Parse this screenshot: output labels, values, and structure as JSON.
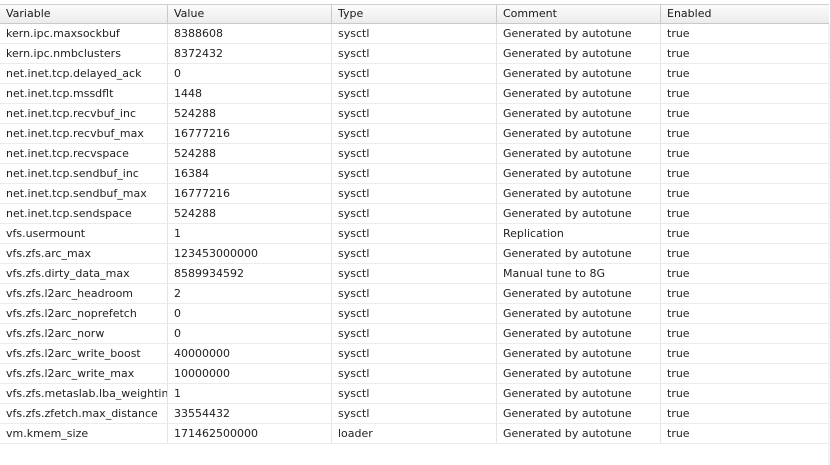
{
  "columns": [
    "Variable",
    "Value",
    "Type",
    "Comment",
    "Enabled"
  ],
  "rows": [
    {
      "variable": "kern.ipc.maxsockbuf",
      "value": "8388608",
      "type": "sysctl",
      "comment": "Generated by autotune",
      "enabled": "true"
    },
    {
      "variable": "kern.ipc.nmbclusters",
      "value": "8372432",
      "type": "sysctl",
      "comment": "Generated by autotune",
      "enabled": "true"
    },
    {
      "variable": "net.inet.tcp.delayed_ack",
      "value": "0",
      "type": "sysctl",
      "comment": "Generated by autotune",
      "enabled": "true"
    },
    {
      "variable": "net.inet.tcp.mssdflt",
      "value": "1448",
      "type": "sysctl",
      "comment": "Generated by autotune",
      "enabled": "true"
    },
    {
      "variable": "net.inet.tcp.recvbuf_inc",
      "value": "524288",
      "type": "sysctl",
      "comment": "Generated by autotune",
      "enabled": "true"
    },
    {
      "variable": "net.inet.tcp.recvbuf_max",
      "value": "16777216",
      "type": "sysctl",
      "comment": "Generated by autotune",
      "enabled": "true"
    },
    {
      "variable": "net.inet.tcp.recvspace",
      "value": "524288",
      "type": "sysctl",
      "comment": "Generated by autotune",
      "enabled": "true"
    },
    {
      "variable": "net.inet.tcp.sendbuf_inc",
      "value": "16384",
      "type": "sysctl",
      "comment": "Generated by autotune",
      "enabled": "true"
    },
    {
      "variable": "net.inet.tcp.sendbuf_max",
      "value": "16777216",
      "type": "sysctl",
      "comment": "Generated by autotune",
      "enabled": "true"
    },
    {
      "variable": "net.inet.tcp.sendspace",
      "value": "524288",
      "type": "sysctl",
      "comment": "Generated by autotune",
      "enabled": "true"
    },
    {
      "variable": "vfs.usermount",
      "value": "1",
      "type": "sysctl",
      "comment": "Replication",
      "enabled": "true"
    },
    {
      "variable": "vfs.zfs.arc_max",
      "value": "123453000000",
      "type": "sysctl",
      "comment": "Generated by autotune",
      "enabled": "true"
    },
    {
      "variable": "vfs.zfs.dirty_data_max",
      "value": "8589934592",
      "type": "sysctl",
      "comment": "Manual tune to 8G",
      "enabled": "true"
    },
    {
      "variable": "vfs.zfs.l2arc_headroom",
      "value": "2",
      "type": "sysctl",
      "comment": "Generated by autotune",
      "enabled": "true"
    },
    {
      "variable": "vfs.zfs.l2arc_noprefetch",
      "value": "0",
      "type": "sysctl",
      "comment": "Generated by autotune",
      "enabled": "true"
    },
    {
      "variable": "vfs.zfs.l2arc_norw",
      "value": "0",
      "type": "sysctl",
      "comment": "Generated by autotune",
      "enabled": "true"
    },
    {
      "variable": "vfs.zfs.l2arc_write_boost",
      "value": "40000000",
      "type": "sysctl",
      "comment": "Generated by autotune",
      "enabled": "true"
    },
    {
      "variable": "vfs.zfs.l2arc_write_max",
      "value": "10000000",
      "type": "sysctl",
      "comment": "Generated by autotune",
      "enabled": "true"
    },
    {
      "variable": "vfs.zfs.metaslab.lba_weighting",
      "value": "1",
      "type": "sysctl",
      "comment": "Generated by autotune",
      "enabled": "true"
    },
    {
      "variable": "vfs.zfs.zfetch.max_distance",
      "value": "33554432",
      "type": "sysctl",
      "comment": "Generated by autotune",
      "enabled": "true"
    },
    {
      "variable": "vm.kmem_size",
      "value": "171462500000",
      "type": "loader",
      "comment": "Generated by autotune",
      "enabled": "true"
    }
  ]
}
